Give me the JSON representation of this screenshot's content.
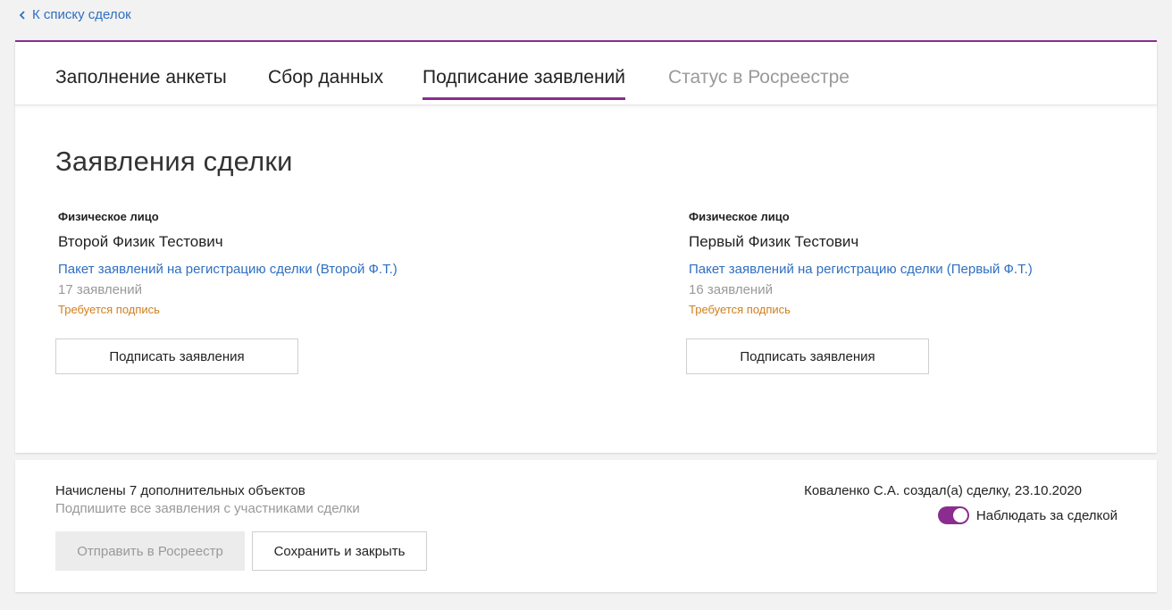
{
  "back": {
    "label": "К списку сделок",
    "icon": "chevron-left-icon"
  },
  "tabs": [
    {
      "label": "Заполнение анкеты",
      "state": "normal"
    },
    {
      "label": "Сбор данных",
      "state": "normal"
    },
    {
      "label": "Подписание заявлений",
      "state": "active"
    },
    {
      "label": "Статус в Росреестре",
      "state": "disabled"
    }
  ],
  "section": {
    "title": "Заявления сделки"
  },
  "parties": [
    {
      "type": "Физическое лицо",
      "name": "Второй Физик Тестович",
      "package_link": "Пакет заявлений на регистрацию сделки (Второй Ф.Т.)",
      "count": "17 заявлений",
      "status": "Требуется подпись",
      "button": "Подписать заявления"
    },
    {
      "type": "Физическое лицо",
      "name": "Первый Физик Тестович",
      "package_link": "Пакет заявлений на регистрацию сделки (Первый Ф.Т.)",
      "count": "16 заявлений",
      "status": "Требуется подпись",
      "button": "Подписать заявления"
    }
  ],
  "footer": {
    "info": "Начислены 7 дополнительных объектов",
    "hint": "Подпишите все заявления с участниками сделки",
    "send_button": "Отправить в Росреестр",
    "save_button": "Сохранить и закрыть",
    "creator": "Коваленко С.А. создал(а) сделку, 23.10.2020",
    "watch_label": "Наблюдать за сделкой",
    "watch_enabled": true
  },
  "colors": {
    "accent": "#8a2d8f",
    "link": "#2f6fc0",
    "warning": "#d07f1c",
    "muted": "#999999"
  }
}
